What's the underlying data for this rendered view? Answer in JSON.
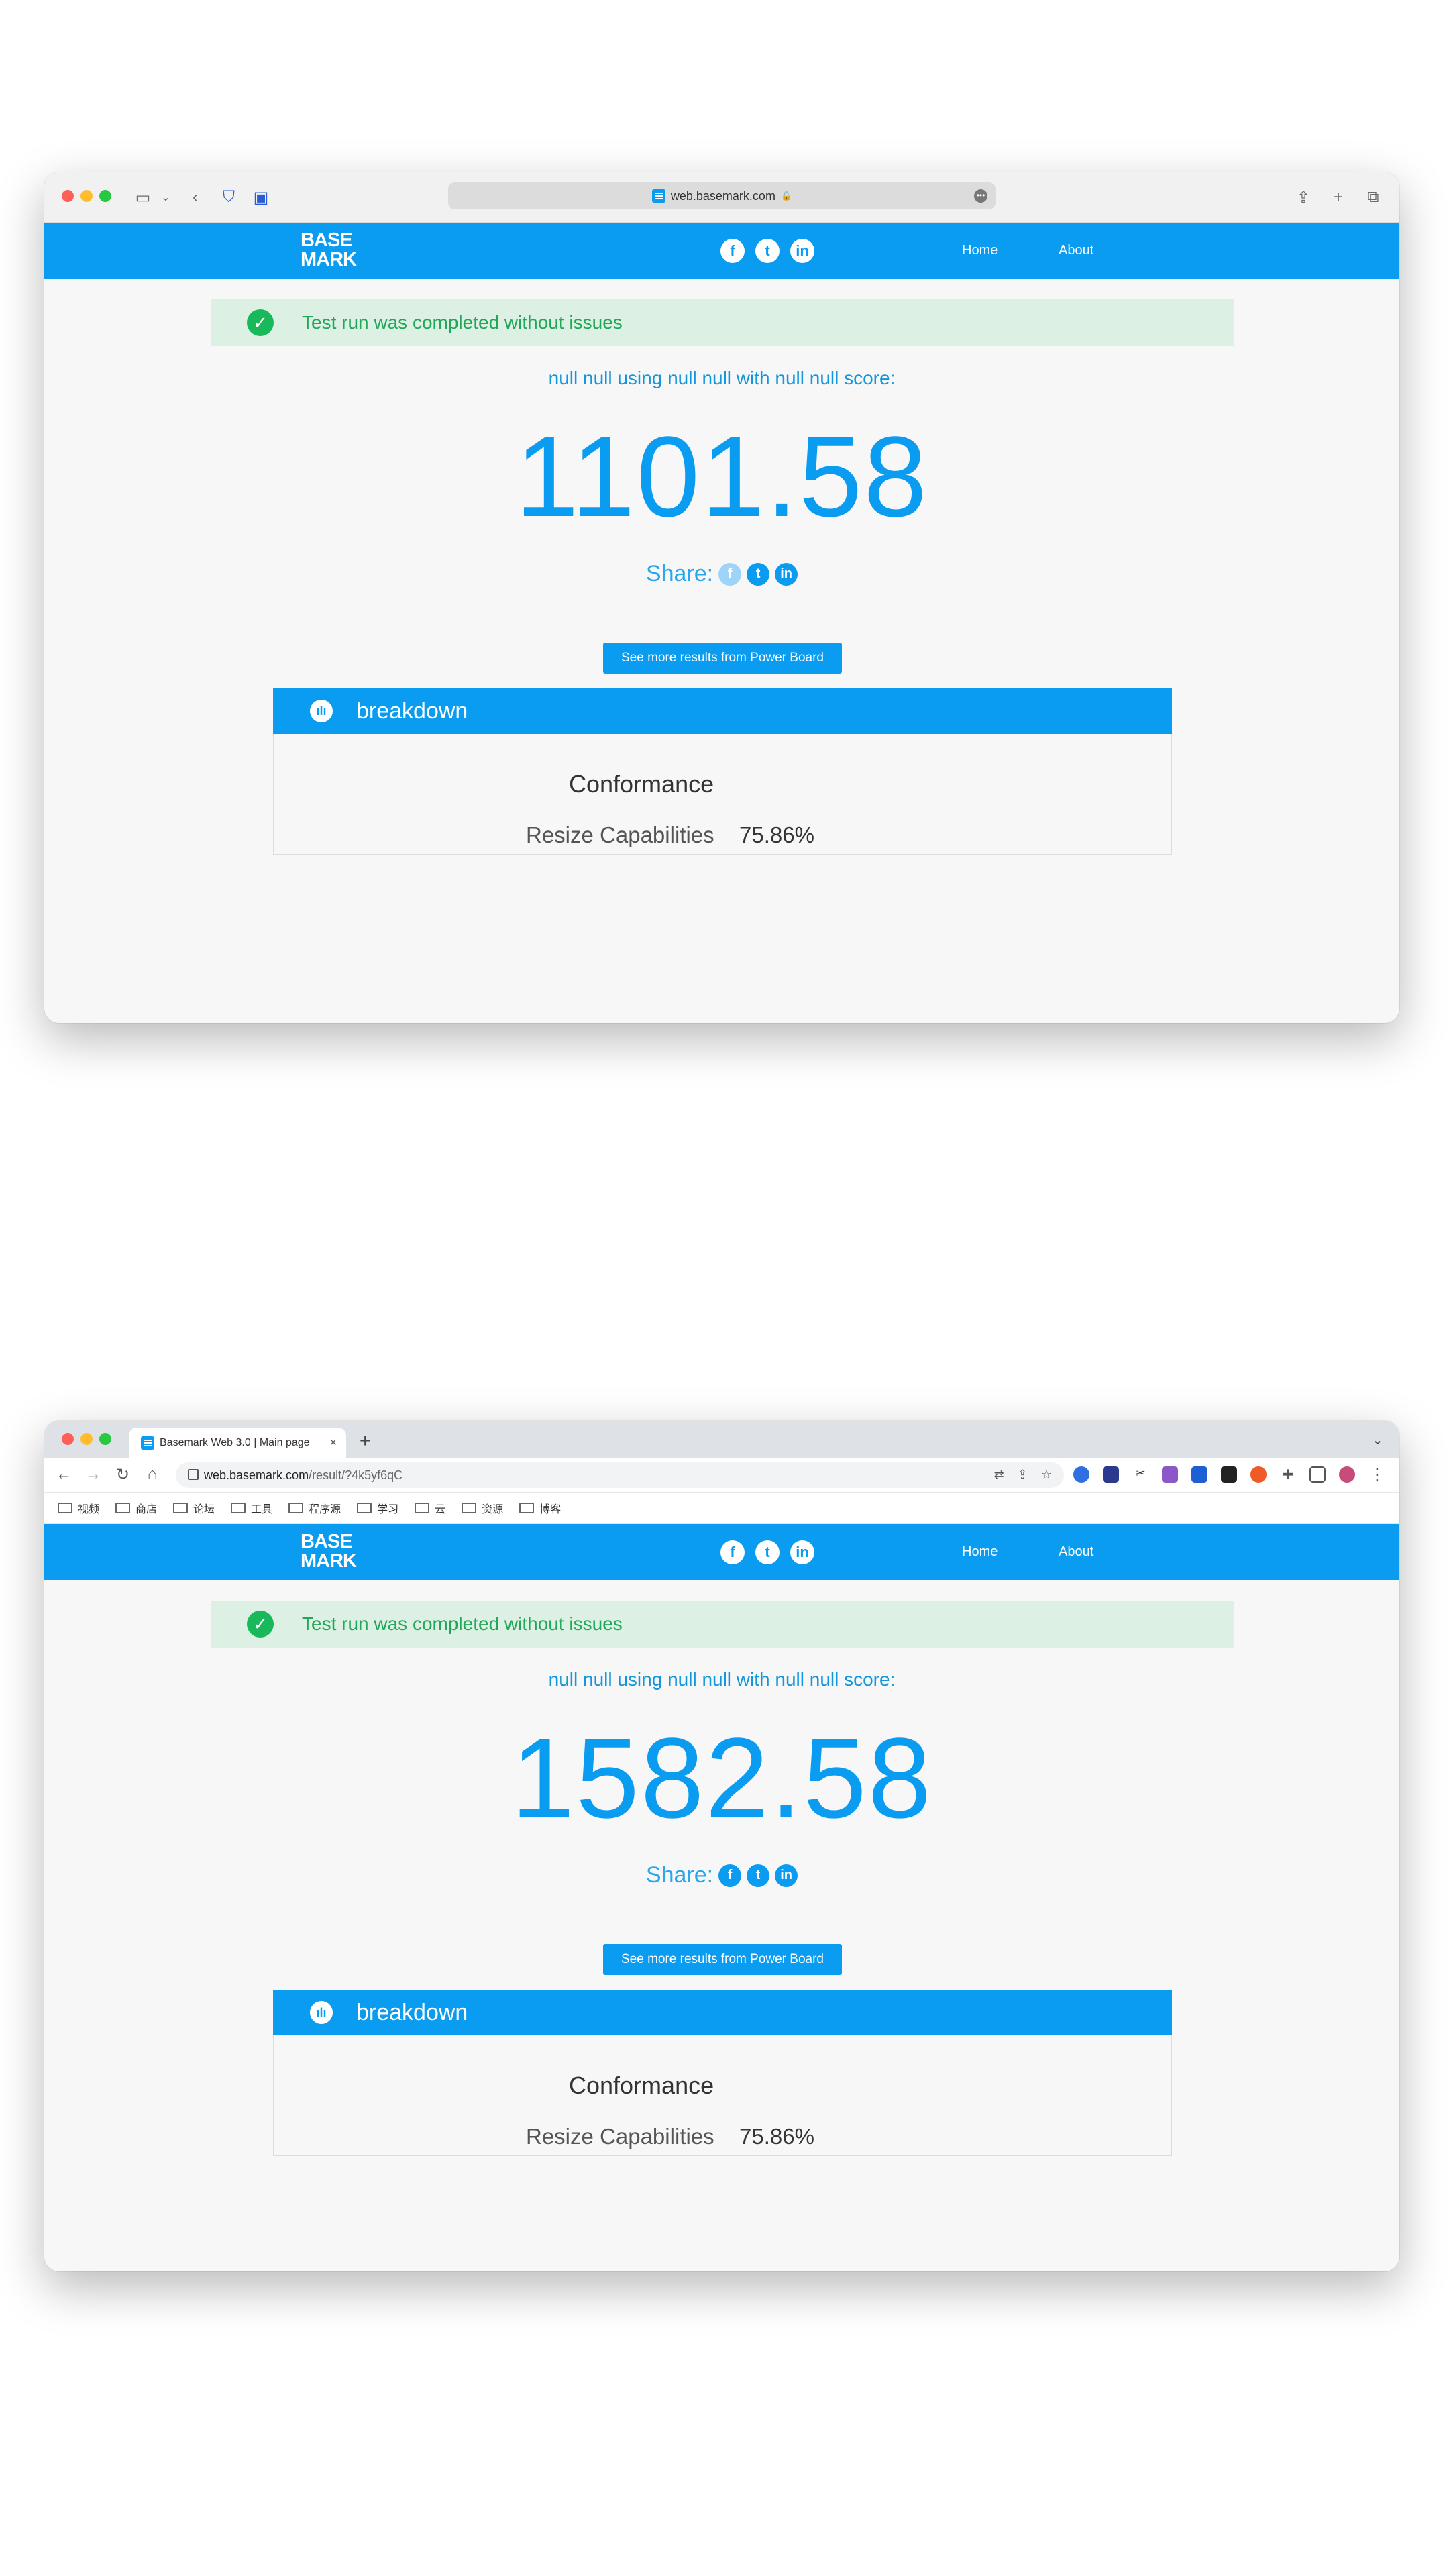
{
  "window1": {
    "browser": {
      "url": "web.basemark.com"
    },
    "site": {
      "logo_line1": "BASE",
      "logo_line2": "MARK",
      "nav": {
        "home": "Home",
        "about": "About"
      },
      "social_icons": [
        "facebook-icon",
        "twitter-icon",
        "linkedin-icon"
      ],
      "alert": "Test run was completed without issues",
      "score_label": "null null using null null with null null score:",
      "score": "1101.58",
      "share_label": "Share:",
      "button": "See more results from Power Board",
      "breakdown_title": "breakdown",
      "conformance": "Conformance",
      "metric_label": "Resize Capabilities",
      "metric_value": "75.86%"
    }
  },
  "window2": {
    "browser": {
      "tab_title": "Basemark Web 3.0 | Main page",
      "url_host": "web.basemark.com",
      "url_path": "/result/?4k5yf6qC",
      "bookmarks": [
        "视频",
        "商店",
        "论坛",
        "工具",
        "程序源",
        "学习",
        "云",
        "资源",
        "博客"
      ]
    },
    "site": {
      "logo_line1": "BASE",
      "logo_line2": "MARK",
      "nav": {
        "home": "Home",
        "about": "About"
      },
      "alert": "Test run was completed without issues",
      "score_label": "null null using null null with null null score:",
      "score": "1582.58",
      "share_label": "Share:",
      "button": "See more results from Power Board",
      "breakdown_title": "breakdown",
      "conformance": "Conformance",
      "metric_label": "Resize Capabilities",
      "metric_value": "75.86%"
    }
  },
  "colors": {
    "brand_blue": "#0a9cf0",
    "success_green": "#22a75a",
    "alert_bg": "#dcf0e3"
  }
}
